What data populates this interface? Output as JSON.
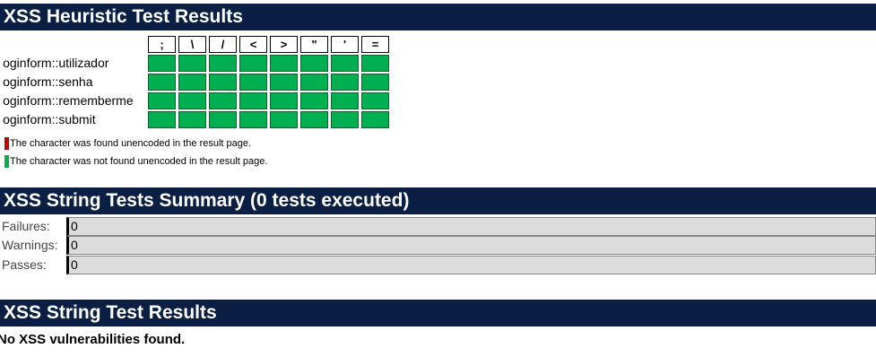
{
  "heuristic": {
    "title": "XSS Heuristic Test Results",
    "characters": [
      ";",
      "\\",
      "/",
      "<",
      ">",
      "\"",
      "'",
      "="
    ],
    "rows": [
      {
        "label": "loginform::utilizador",
        "results": [
          "ok",
          "ok",
          "ok",
          "ok",
          "ok",
          "ok",
          "ok",
          "ok"
        ]
      },
      {
        "label": "loginform::senha",
        "results": [
          "ok",
          "ok",
          "ok",
          "ok",
          "ok",
          "ok",
          "ok",
          "ok"
        ]
      },
      {
        "label": "loginform::rememberme",
        "results": [
          "ok",
          "ok",
          "ok",
          "ok",
          "ok",
          "ok",
          "ok",
          "ok"
        ]
      },
      {
        "label": "loginform::submit",
        "results": [
          "ok",
          "ok",
          "ok",
          "ok",
          "ok",
          "ok",
          "ok",
          "ok"
        ]
      }
    ],
    "legend": {
      "found_text": "The character was found unencoded in the result page.",
      "found_color": "#c00000",
      "not_found_text": "The character was not found unencoded in the result page.",
      "not_found_color": "#00b050"
    }
  },
  "summary": {
    "title": "XSS String Tests Summary (0 tests executed)",
    "failures_label": "Failures:",
    "failures_value": "0",
    "warnings_label": "Warnings:",
    "warnings_value": "0",
    "passes_label": "Passes:",
    "passes_value": "0"
  },
  "results": {
    "title": "XSS String Test Results",
    "message": "No XSS vulnerabilities found."
  },
  "colors": {
    "header_bg": "#0b1f44",
    "pass_green": "#00b050",
    "fail_red": "#c00000"
  }
}
